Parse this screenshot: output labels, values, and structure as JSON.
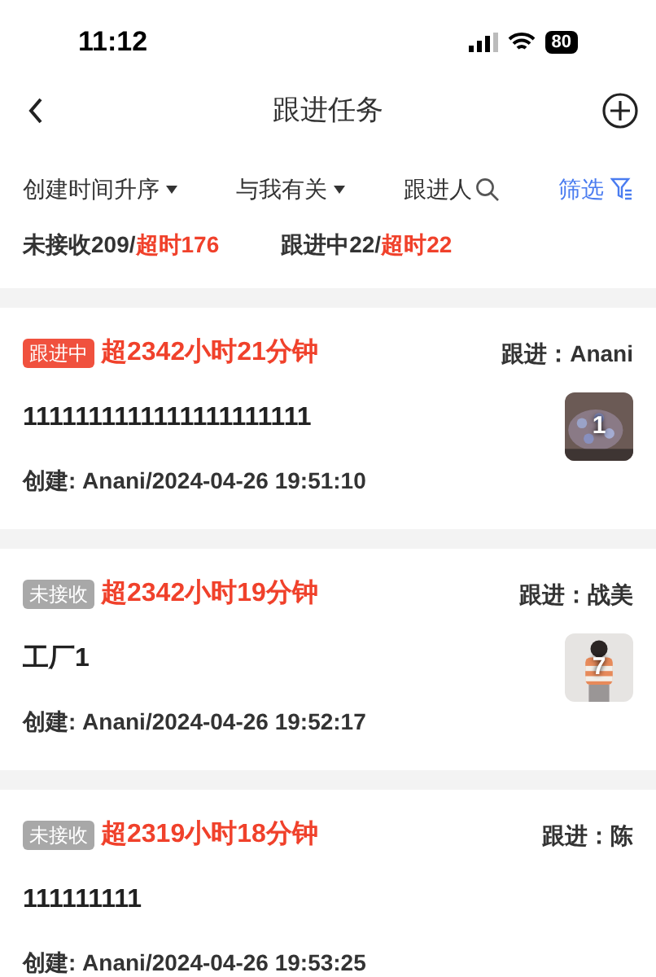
{
  "status_bar": {
    "time": "11:12",
    "battery": "80"
  },
  "header": {
    "title": "跟进任务"
  },
  "filters": [
    {
      "label": "创建时间升序",
      "kind": "dropdown"
    },
    {
      "label": "与我有关",
      "kind": "dropdown"
    },
    {
      "label": "跟进人",
      "kind": "search"
    },
    {
      "label": "筛选",
      "kind": "filter"
    }
  ],
  "counts": [
    {
      "label": "未接收209/",
      "overdue": "超时176"
    },
    {
      "label": "跟进中22/",
      "overdue": "超时22"
    }
  ],
  "tasks": [
    {
      "status": "跟进中",
      "kind": "following",
      "overdue": "超2342小时21分钟",
      "follower": "跟进：Anani",
      "title": "1111111111111111111111",
      "created": "创建: Anani/2024-04-26 19:51:10",
      "photo": {
        "count": "1"
      }
    },
    {
      "status": "未接收",
      "kind": "unaccepted",
      "overdue": "超2342小时19分钟",
      "follower": "跟进：战美",
      "title": "工厂1",
      "created": "创建: Anani/2024-04-26 19:52:17",
      "photo": {
        "count": "7"
      }
    },
    {
      "status": "未接收",
      "kind": "unaccepted",
      "overdue": "超2319小时18分钟",
      "follower": "跟进：陈",
      "title": "111111111",
      "created": "创建: Anani/2024-04-26 19:53:25"
    }
  ]
}
